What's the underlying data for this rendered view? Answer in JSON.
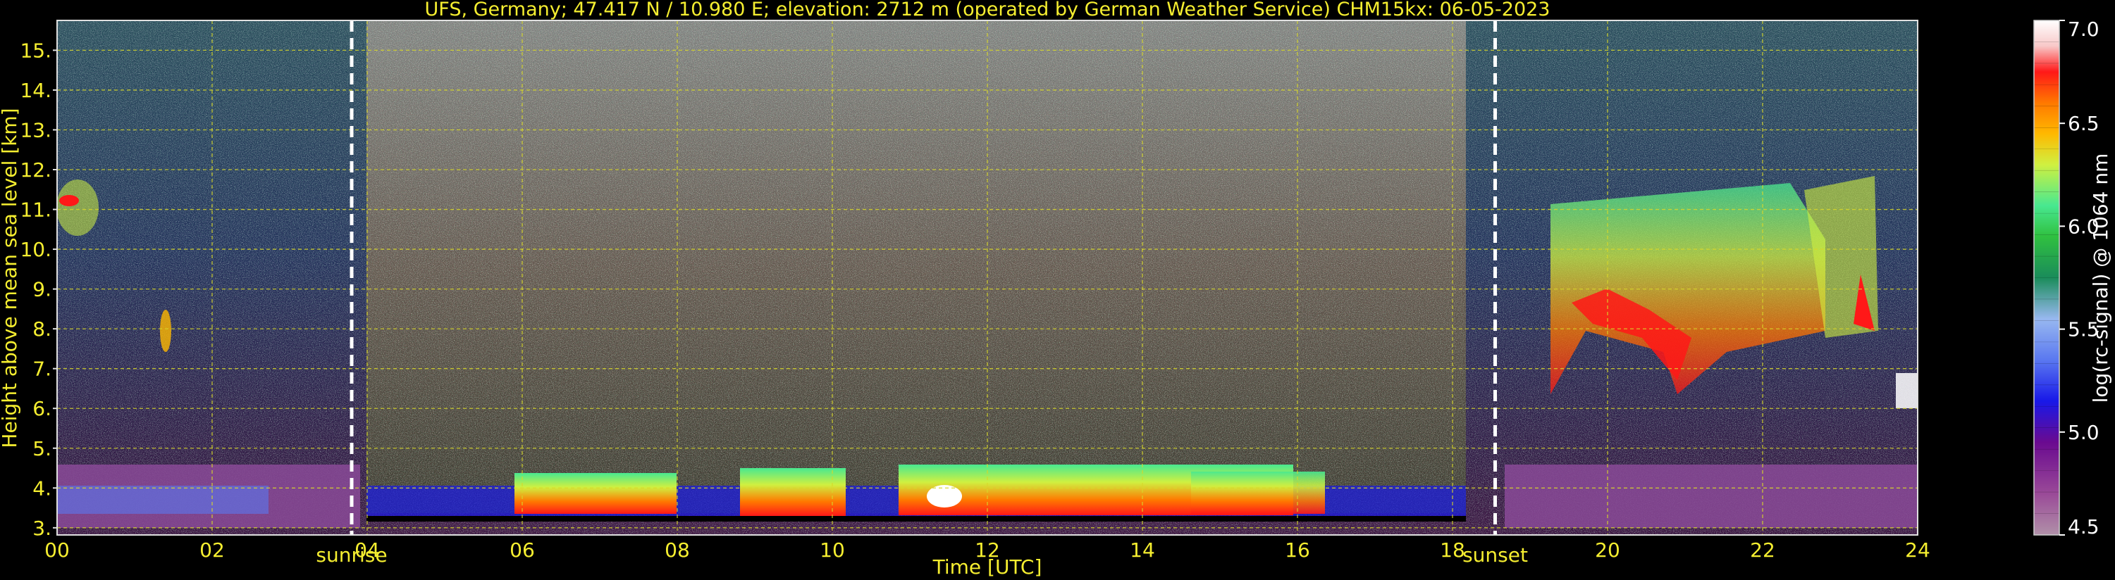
{
  "chart_data": {
    "type": "heatmap",
    "title": "UFS, Germany; 47.417 N / 10.980 E; elevation: 2712 m  (operated by German Weather Service)    CHM15kx: 06-05-2023",
    "xlabel": "Time [UTC]",
    "ylabel": "Height above mean sea level [km]",
    "colorbar_label": "log(rc-signal) @ 1064 nm",
    "x_ticks": [
      "00",
      "02",
      "04",
      "06",
      "08",
      "10",
      "12",
      "14",
      "16",
      "18",
      "20",
      "22",
      "24"
    ],
    "y_ticks": [
      "3.",
      "4.",
      "5.",
      "6.",
      "7.",
      "8.",
      "9.",
      "10.",
      "11.",
      "12.",
      "13.",
      "14.",
      "15."
    ],
    "xlim": [
      0,
      24
    ],
    "ylim": [
      2.82,
      15.75
    ],
    "colorbar_ticks": [
      "7.0",
      "6.5",
      "6.0",
      "5.5",
      "5.0",
      "4.5"
    ],
    "colorbar_range": [
      4.5,
      7.0
    ],
    "grid": true,
    "markers": [
      {
        "label": "sunrise",
        "x": 3.8
      },
      {
        "label": "sunset",
        "x": 18.55
      }
    ],
    "colors": {
      "text": "#f5ee30",
      "grid": "#d8d82a",
      "background": "#000000",
      "colormap": [
        "#b090a8",
        "#9a4a98",
        "#6a0a90",
        "#1818e8",
        "#5a78f0",
        "#98b8f0",
        "#1a8c5a",
        "#30c040",
        "#48e890",
        "#d0f040",
        "#ffb800",
        "#ff7800",
        "#ff1818",
        "#f8c8c8",
        "#ffffff"
      ]
    }
  }
}
